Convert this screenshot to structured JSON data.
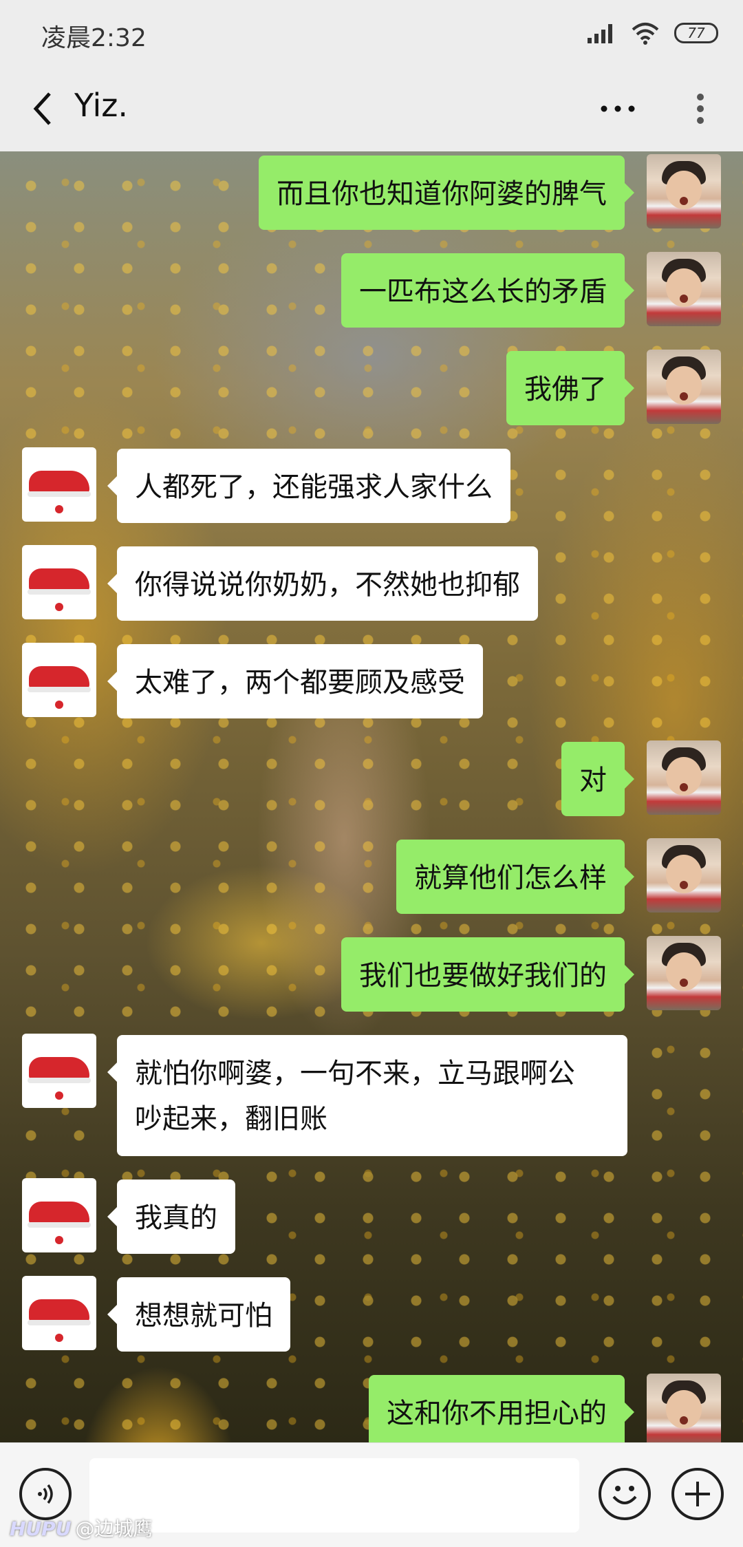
{
  "status_bar": {
    "time": "凌晨2:32",
    "battery": "77",
    "icons": [
      "signal-icon",
      "wifi-icon",
      "battery-icon"
    ]
  },
  "header": {
    "title": "Yiz.",
    "icons": [
      "back-icon",
      "more-dots-icon",
      "menu-kebab-icon"
    ]
  },
  "messages": [
    {
      "side": "me",
      "text": "而且你也知道你阿婆的脾气"
    },
    {
      "side": "me",
      "text": "一匹布这么长的矛盾"
    },
    {
      "side": "me",
      "text": "我佛了"
    },
    {
      "side": "other",
      "text": "人都死了，还能强求人家什么"
    },
    {
      "side": "other",
      "text": "你得说说你奶奶，不然她也抑郁"
    },
    {
      "side": "other",
      "text": "太难了，两个都要顾及感受"
    },
    {
      "side": "me",
      "text": "对"
    },
    {
      "side": "me",
      "text": "就算他们怎么样"
    },
    {
      "side": "me",
      "text": "我们也要做好我们的"
    },
    {
      "side": "other",
      "text": "就怕你啊婆，一句不来，立马跟啊公\n吵起来，翻旧账"
    },
    {
      "side": "other",
      "text": "我真的"
    },
    {
      "side": "other",
      "text": "想想就可怕"
    },
    {
      "side": "me",
      "text": "这和你不用担心的"
    }
  ],
  "input_bar": {
    "icons": [
      "voice-icon",
      "emoji-icon",
      "plus-icon"
    ]
  },
  "watermark": {
    "brand": "HUPU",
    "user": "@边城鹰"
  },
  "colors": {
    "my_bubble": "#95ec69",
    "their_bubble": "#ffffff",
    "bar_bg": "#ededed"
  }
}
